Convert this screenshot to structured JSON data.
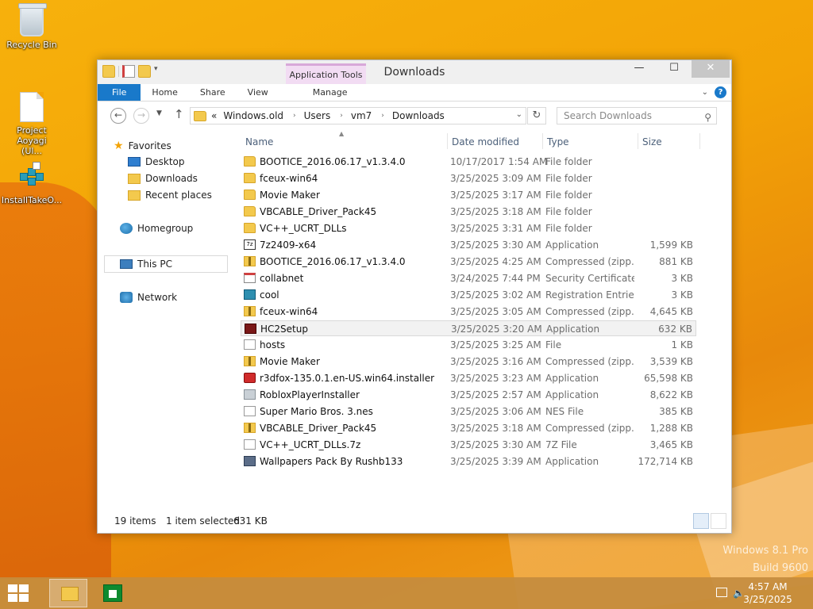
{
  "desktop": {
    "icons": [
      {
        "label": "Recycle Bin"
      },
      {
        "label": "Project Aoyagi (Ul..."
      },
      {
        "label": "InstallTakeO..."
      }
    ],
    "watermark_line1": "Windows 8.1 Pro",
    "watermark_line2": "Build 9600"
  },
  "window": {
    "title": "Downloads",
    "contextual_tab": "Application Tools",
    "controls": {
      "minimize": "—",
      "maximize": "☐",
      "close": "✕"
    },
    "ribbon_tabs": [
      "File",
      "Home",
      "Share",
      "View",
      "Manage"
    ],
    "address": {
      "prefix": "«",
      "segments": [
        "Windows.old",
        "Users",
        "vm7",
        "Downloads"
      ]
    },
    "search_placeholder": "Search Downloads",
    "nav_pane": {
      "favorites": "Favorites",
      "desktop": "Desktop",
      "downloads": "Downloads",
      "recent": "Recent places",
      "homegroup": "Homegroup",
      "this_pc": "This PC",
      "network": "Network"
    },
    "columns": {
      "name": "Name",
      "date": "Date modified",
      "type": "Type",
      "size": "Size"
    },
    "files": [
      {
        "name": "BOOTICE_2016.06.17_v1.3.4.0",
        "date": "10/17/2017 1:54 AM",
        "type": "File folder",
        "size": "",
        "icon": "folder"
      },
      {
        "name": "fceux-win64",
        "date": "3/25/2025 3:09 AM",
        "type": "File folder",
        "size": "",
        "icon": "folder"
      },
      {
        "name": "Movie Maker",
        "date": "3/25/2025 3:17 AM",
        "type": "File folder",
        "size": "",
        "icon": "folder"
      },
      {
        "name": "VBCABLE_Driver_Pack45",
        "date": "3/25/2025 3:18 AM",
        "type": "File folder",
        "size": "",
        "icon": "folder"
      },
      {
        "name": "VC++_UCRT_DLLs",
        "date": "3/25/2025 3:31 AM",
        "type": "File folder",
        "size": "",
        "icon": "folder"
      },
      {
        "name": "7z2409-x64",
        "date": "3/25/2025 3:30 AM",
        "type": "Application",
        "size": "1,599 KB",
        "icon": "7z"
      },
      {
        "name": "BOOTICE_2016.06.17_v1.3.4.0",
        "date": "3/25/2025 4:25 AM",
        "type": "Compressed (zipp...",
        "size": "881 KB",
        "icon": "zip"
      },
      {
        "name": "collabnet",
        "date": "3/24/2025 7:44 PM",
        "type": "Security Certificate",
        "size": "3 KB",
        "icon": "cert"
      },
      {
        "name": "cool",
        "date": "3/25/2025 3:02 AM",
        "type": "Registration Entries",
        "size": "3 KB",
        "icon": "reg"
      },
      {
        "name": "fceux-win64",
        "date": "3/25/2025 3:05 AM",
        "type": "Compressed (zipp...",
        "size": "4,645 KB",
        "icon": "zip"
      },
      {
        "name": "HC2Setup",
        "date": "3/25/2025 3:20 AM",
        "type": "Application",
        "size": "632 KB",
        "icon": "hc2"
      },
      {
        "name": "hosts",
        "date": "3/25/2025 3:25 AM",
        "type": "File",
        "size": "1 KB",
        "icon": "file"
      },
      {
        "name": "Movie Maker",
        "date": "3/25/2025 3:16 AM",
        "type": "Compressed (zipp...",
        "size": "3,539 KB",
        "icon": "zip"
      },
      {
        "name": "r3dfox-135.0.1.en-US.win64.installer",
        "date": "3/25/2025 3:23 AM",
        "type": "Application",
        "size": "65,598 KB",
        "icon": "fox"
      },
      {
        "name": "RobloxPlayerInstaller",
        "date": "3/25/2025 2:57 AM",
        "type": "Application",
        "size": "8,622 KB",
        "icon": "roblox"
      },
      {
        "name": "Super Mario Bros. 3.nes",
        "date": "3/25/2025 3:06 AM",
        "type": "NES File",
        "size": "385 KB",
        "icon": "file"
      },
      {
        "name": "VBCABLE_Driver_Pack45",
        "date": "3/25/2025 3:18 AM",
        "type": "Compressed (zipp...",
        "size": "1,288 KB",
        "icon": "zip"
      },
      {
        "name": "VC++_UCRT_DLLs.7z",
        "date": "3/25/2025 3:30 AM",
        "type": "7Z File",
        "size": "3,465 KB",
        "icon": "file"
      },
      {
        "name": "Wallpapers Pack By Rushb133",
        "date": "3/25/2025 3:39 AM",
        "type": "Application",
        "size": "172,714 KB",
        "icon": "wall"
      }
    ],
    "selected_index": 10,
    "status": {
      "items": "19 items",
      "selected": "1 item selected",
      "size": "631 KB"
    }
  },
  "taskbar": {
    "time": "4:57 AM",
    "date": "3/25/2025"
  }
}
